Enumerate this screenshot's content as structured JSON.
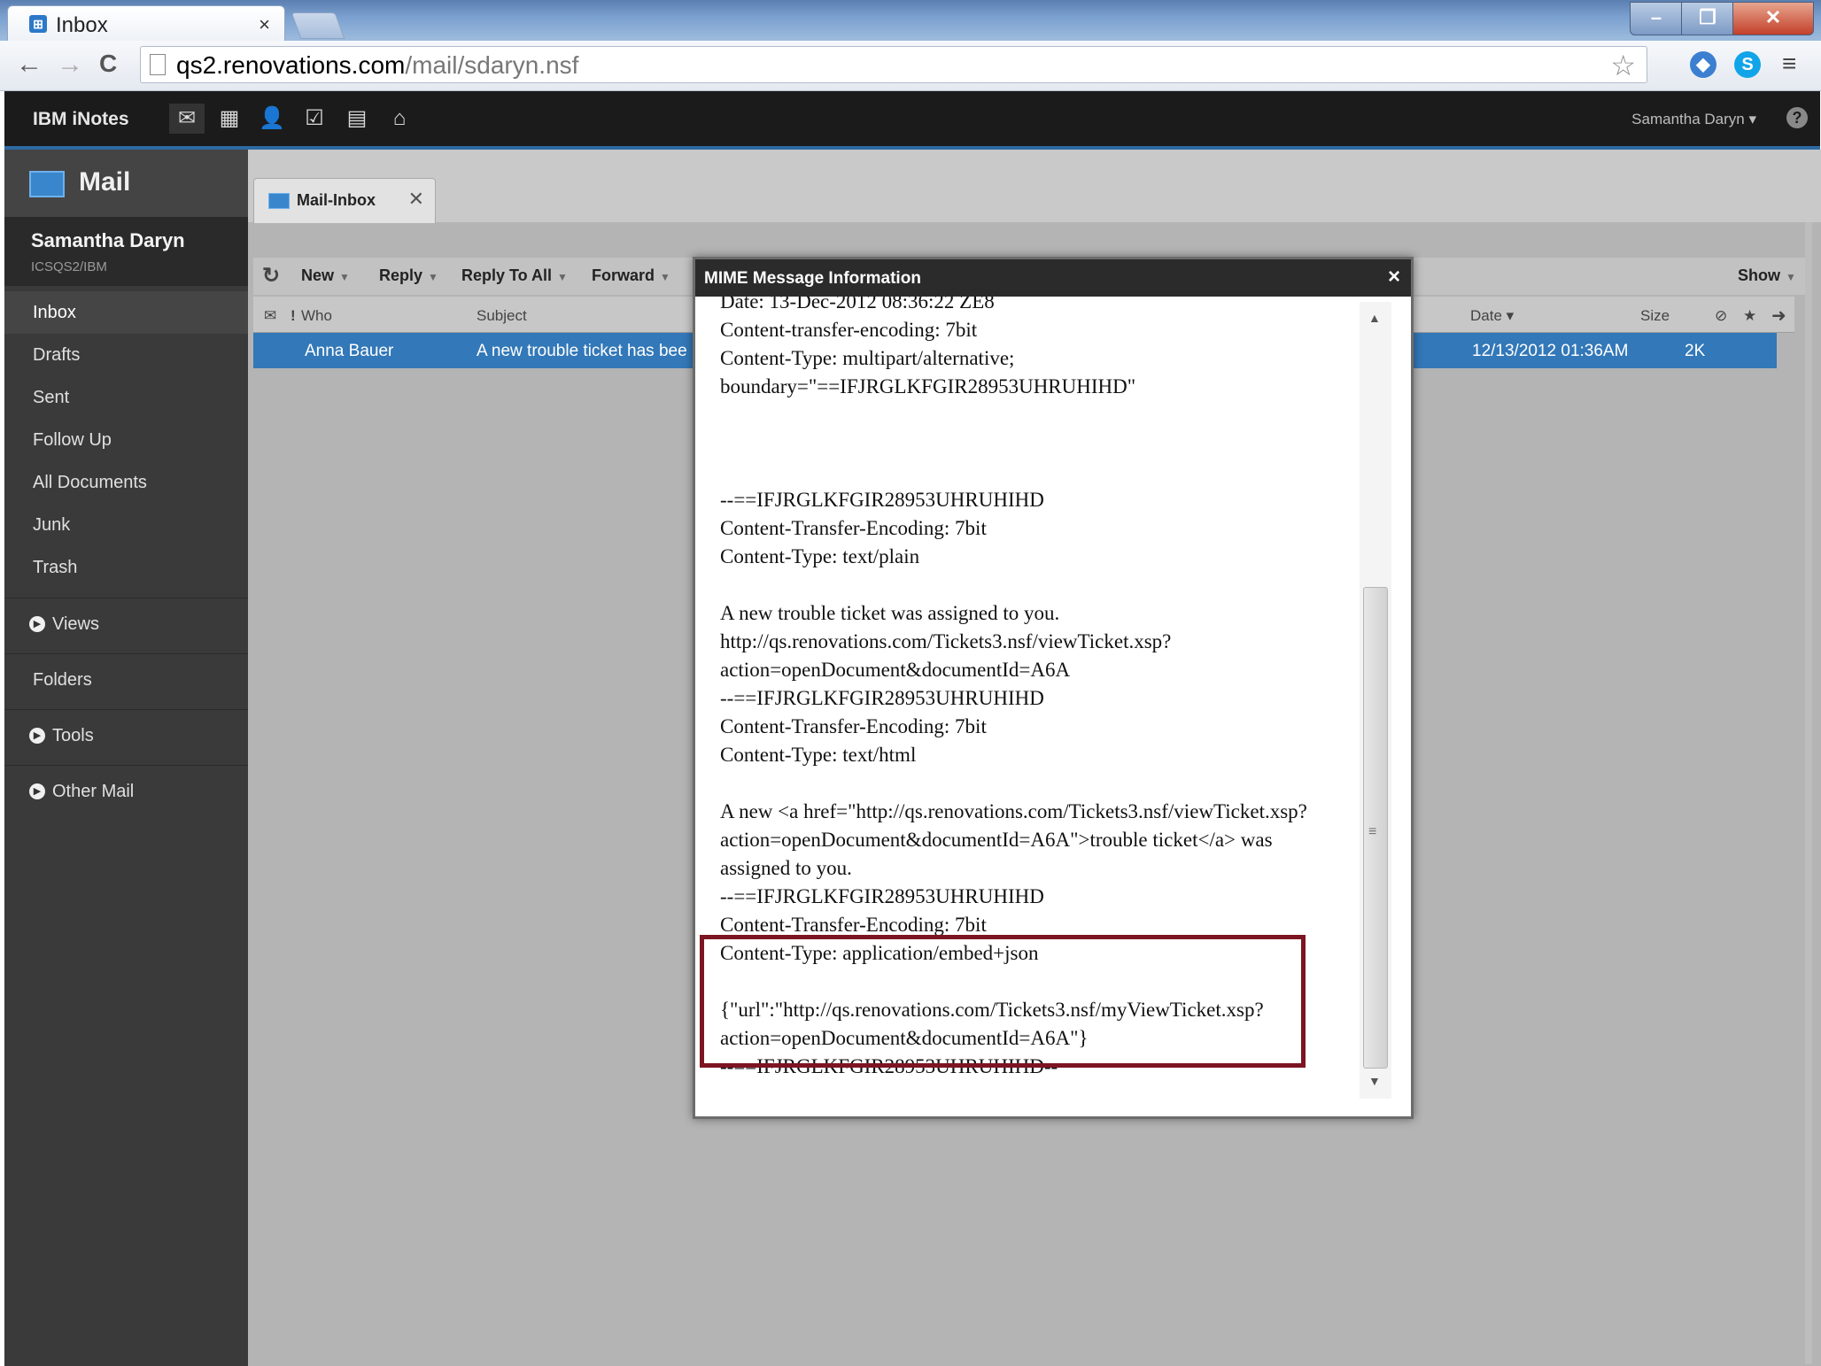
{
  "browser": {
    "tab_title": "Inbox",
    "tab_close": "×",
    "url_host": "qs2.renovations.com",
    "url_path": "/mail/sdaryn.nsf",
    "back": "←",
    "forward": "→",
    "reload": "C"
  },
  "app": {
    "brand": "IBM iNotes",
    "user_menu": "Samantha Daryn",
    "help": "?"
  },
  "left": {
    "title": "Mail",
    "user_name": "Samantha Daryn",
    "user_server": "ICSQS2/IBM",
    "folders": [
      "Inbox",
      "Drafts",
      "Sent",
      "Follow Up",
      "All Documents",
      "Junk",
      "Trash"
    ],
    "sections": [
      "Views",
      "Folders",
      "Tools",
      "Other Mail"
    ]
  },
  "main": {
    "tab_label": "Mail-Inbox",
    "actions": {
      "new": "New",
      "reply": "Reply",
      "reply_all": "Reply To All",
      "forward": "Forward",
      "show": "Show"
    },
    "columns": {
      "flag": "!",
      "who": "Who",
      "subject": "Subject",
      "date": "Date",
      "size": "Size"
    },
    "rows": [
      {
        "who": "Anna Bauer",
        "subject": "A new trouble ticket has bee",
        "date": "12/13/2012 01:36AM",
        "size": "2K"
      }
    ]
  },
  "dialog": {
    "title": "MIME Message Information",
    "close": "×",
    "content": "Date: 13-Dec-2012 08:36:22 ZE8\nContent-transfer-encoding: 7bit\nContent-Type: multipart/alternative;\nboundary=\"==IFJRGLKFGIR28953UHRUHIHD\"\n\n\n\n--==IFJRGLKFGIR28953UHRUHIHD\nContent-Transfer-Encoding: 7bit\nContent-Type: text/plain\n\nA new trouble ticket was assigned to you.\nhttp://qs.renovations.com/Tickets3.nsf/viewTicket.xsp?\naction=openDocument&documentId=A6A\n--==IFJRGLKFGIR28953UHRUHIHD\nContent-Transfer-Encoding: 7bit\nContent-Type: text/html\n\nA new <a href=\"http://qs.renovations.com/Tickets3.nsf/viewTicket.xsp?\naction=openDocument&documentId=A6A\">trouble ticket</a> was\nassigned to you.\n--==IFJRGLKFGIR28953UHRUHIHD\nContent-Transfer-Encoding: 7bit\nContent-Type: application/embed+json\n\n{\"url\":\"http://qs.renovations.com/Tickets3.nsf/myViewTicket.xsp?\naction=openDocument&documentId=A6A\"}\n--==IFJRGLKFGIR28953UHRUHIHD--"
  },
  "colors": {
    "banner": "#1b1b1b",
    "accent_blue": "#3378b8",
    "highlight_box": "#7d1423",
    "sidebar": "#3a3a3a"
  },
  "icons": [
    "back-icon",
    "forward-icon",
    "reload-icon",
    "page-icon",
    "star-icon",
    "mail-icon",
    "calendar-icon",
    "contacts-icon",
    "todo-icon",
    "notebook-icon",
    "home-icon",
    "help-icon",
    "envelope-icon",
    "refresh-icon",
    "attachment-icon",
    "importance-icon",
    "next-icon"
  ]
}
